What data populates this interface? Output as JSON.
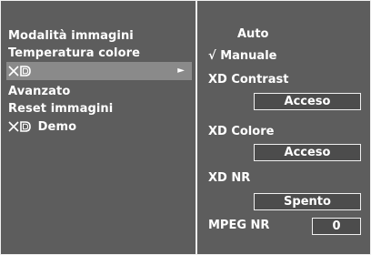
{
  "left_menu": {
    "items": [
      {
        "label": "Modalità immagini"
      },
      {
        "label": "Temperatura colore"
      },
      {
        "label": "XD",
        "selected": true,
        "arrow": "►"
      },
      {
        "label": "Avanzato"
      },
      {
        "label": "Reset immagini"
      },
      {
        "label": "Demo",
        "logo": "XD"
      }
    ]
  },
  "right_panel": {
    "auto_label": "Auto",
    "manual_check": "√",
    "manual_label": "Manuale",
    "xd_contrast": {
      "label": "XD Contrast",
      "value": "Acceso"
    },
    "xd_colore": {
      "label": "XD Colore",
      "value": "Acceso"
    },
    "xd_nr": {
      "label": "XD NR",
      "value": "Spento"
    },
    "mpeg_nr": {
      "label": "MPEG NR",
      "value": "0"
    }
  },
  "colors": {
    "background": "#5d5d5d",
    "selected": "#8a8a8a",
    "border": "#f0f0f0",
    "text": "#ffffff"
  }
}
